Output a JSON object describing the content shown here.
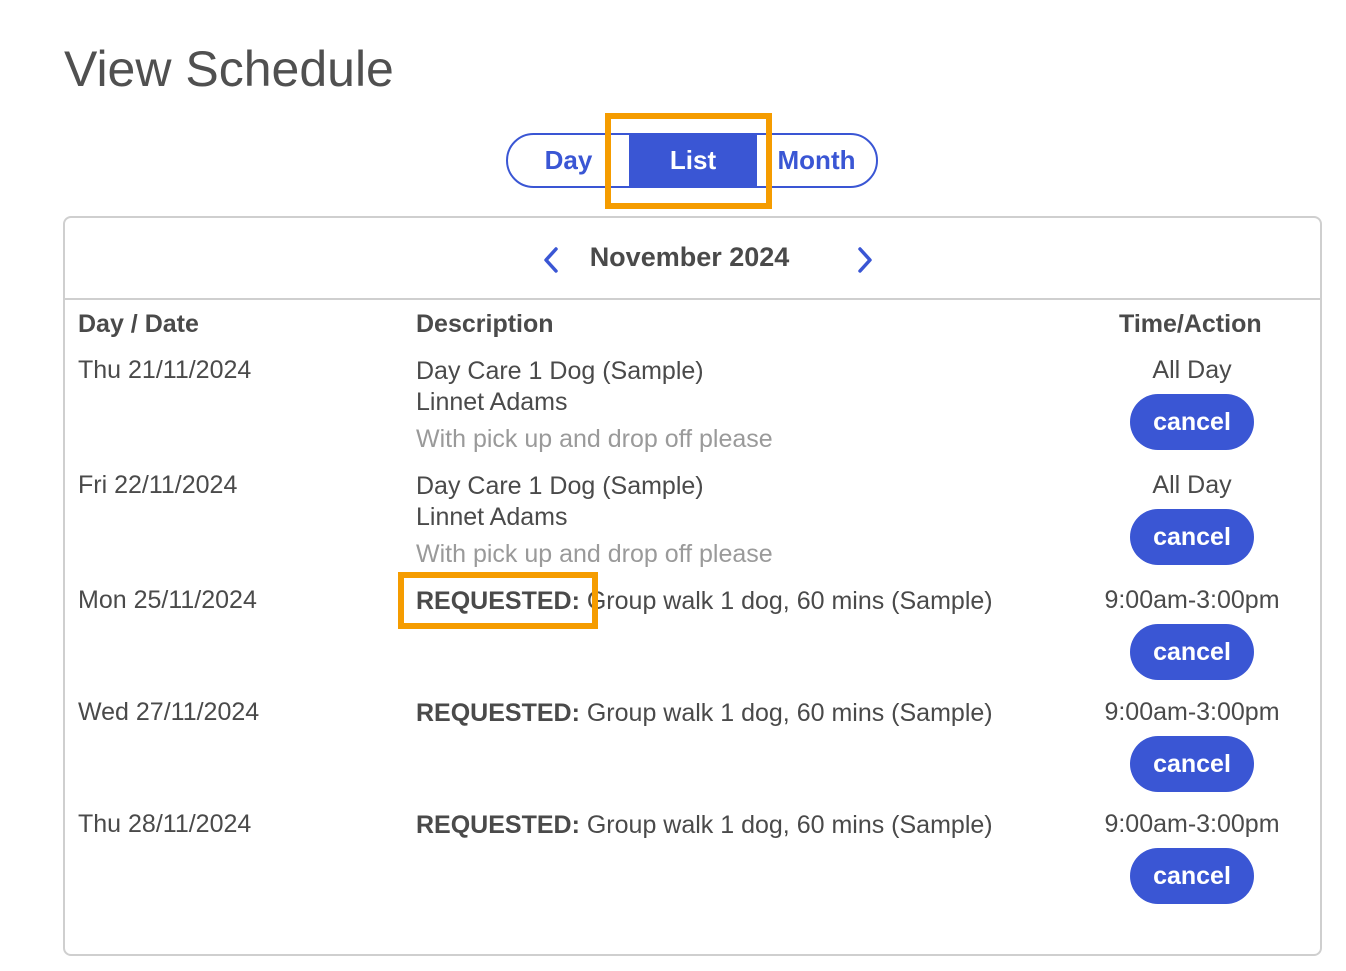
{
  "page": {
    "title": "View Schedule"
  },
  "view_toggle": {
    "day": "Day",
    "list": "List",
    "month": "Month",
    "selected": "List"
  },
  "calendar": {
    "month_label": "November 2024",
    "columns": {
      "date": "Day / Date",
      "description": "Description",
      "time_action": "Time/Action"
    },
    "rows": [
      {
        "date": "Thu 21/11/2024",
        "tag": "",
        "title": "Day Care 1 Dog (Sample)",
        "client": "Linnet Adams",
        "note": "With pick up and drop off please",
        "time": "All Day",
        "action": "cancel"
      },
      {
        "date": "Fri 22/11/2024",
        "tag": "",
        "title": "Day Care 1 Dog (Sample)",
        "client": "Linnet Adams",
        "note": "With pick up and drop off please",
        "time": "All Day",
        "action": "cancel"
      },
      {
        "date": "Mon 25/11/2024",
        "tag": "REQUESTED:",
        "title": "Group walk 1 dog, 60 mins (Sample)",
        "time": "9:00am-3:00pm",
        "action": "cancel"
      },
      {
        "date": "Wed 27/11/2024",
        "tag": "REQUESTED:",
        "title": "Group walk 1 dog, 60 mins (Sample)",
        "time": "9:00am-3:00pm",
        "action": "cancel"
      },
      {
        "date": "Thu 28/11/2024",
        "tag": "REQUESTED:",
        "title": "Group walk 1 dog, 60 mins (Sample)",
        "time": "9:00am-3:00pm",
        "action": "cancel"
      }
    ]
  },
  "colors": {
    "accent": "#3a56d4",
    "highlight": "#f59c00",
    "text": "#4a4a4a",
    "muted": "#9a9a9a"
  }
}
